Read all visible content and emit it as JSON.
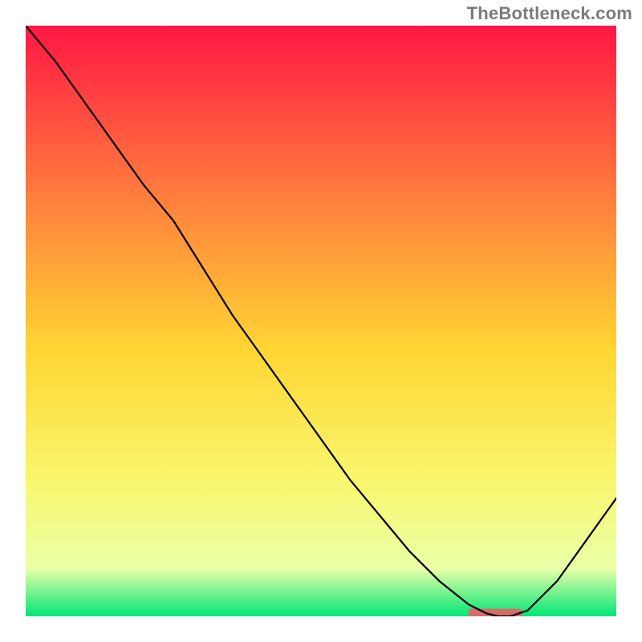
{
  "watermark": "TheBottleneck.com",
  "colors": {
    "gradient_top": "#ff1744",
    "gradient_mid_upper": "#ff7a3d",
    "gradient_mid": "#ffd633",
    "gradient_mid_lower": "#f9f871",
    "gradient_lower": "#e9ffa8",
    "gradient_bottom": "#00e676",
    "curve": "#000000",
    "marker": "#d86a6a"
  },
  "chart_data": {
    "type": "line",
    "title": "",
    "xlabel": "",
    "ylabel": "",
    "xlim": [
      0,
      100
    ],
    "ylim": [
      0,
      100
    ],
    "grid": false,
    "legend": false,
    "series": [
      {
        "name": "bottleneck-curve",
        "x": [
          0,
          5,
          10,
          15,
          20,
          25,
          30,
          35,
          40,
          45,
          50,
          55,
          60,
          65,
          70,
          75,
          78,
          80,
          82,
          85,
          90,
          95,
          100
        ],
        "y": [
          100,
          94,
          87,
          80,
          73,
          67,
          59,
          51,
          44,
          37,
          30,
          23,
          17,
          11,
          6,
          2,
          0.5,
          0,
          0,
          1,
          6,
          13,
          20
        ]
      }
    ],
    "annotations": [
      {
        "name": "valley-marker",
        "x_start": 75,
        "x_end": 84,
        "y": 0.6,
        "shape": "rounded-bar"
      }
    ]
  }
}
